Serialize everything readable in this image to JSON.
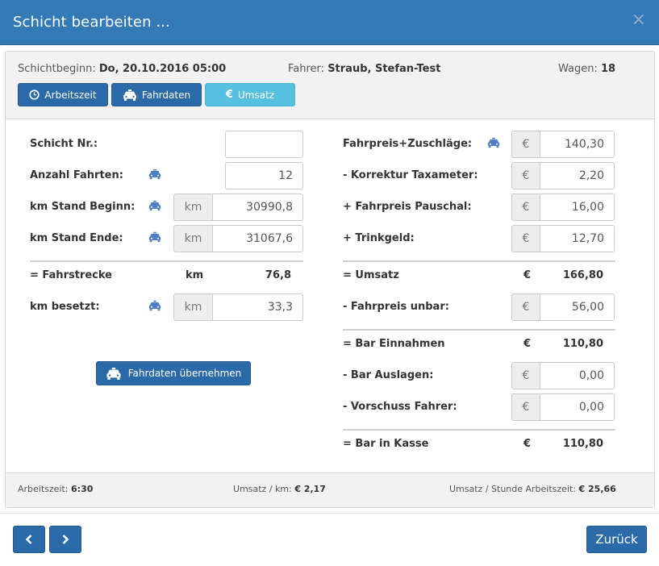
{
  "dialog": {
    "title": "Schicht bearbeiten ...",
    "close_symbol": "×"
  },
  "header": {
    "schichtbeginn_label": "Schichtbeginn:",
    "schichtbeginn_value": "Do, 20.10.2016 05:00",
    "fahrer_label": "Fahrer:",
    "fahrer_value": "Straub, Stefan-Test",
    "wagen_label": "Wagen:",
    "wagen_value": "18"
  },
  "tabs": [
    {
      "label": "Arbeitszeit",
      "icon": "clock-icon"
    },
    {
      "label": "Fahrdaten",
      "icon": "taxi-icon"
    },
    {
      "label": "Umsatz",
      "icon": "euro-icon",
      "active": true
    }
  ],
  "left": {
    "schicht_nr": {
      "label": "Schicht Nr.:",
      "value": ""
    },
    "anzahl_fahrten": {
      "label": "Anzahl Fahrten:",
      "value": "12"
    },
    "km_stand_beginn": {
      "label": "km Stand Beginn:",
      "unit": "km",
      "value": "30990,8"
    },
    "km_stand_ende": {
      "label": "km Stand Ende:",
      "unit": "km",
      "value": "31067,6"
    },
    "fahrstrecke": {
      "label": "= Fahrstrecke",
      "unit": "km",
      "value": "76,8"
    },
    "km_besetzt": {
      "label": "km besetzt:",
      "unit": "km",
      "value": "33,3"
    },
    "action_label": "Fahrdaten übernehmen"
  },
  "right": {
    "fahrpreis_zuschlaege": {
      "label": "Fahrpreis+Zuschläge:",
      "unit": "€",
      "value": "140,30"
    },
    "korrektur_taxameter": {
      "label": "- Korrektur Taxameter:",
      "unit": "€",
      "value": "2,20"
    },
    "fahrpreis_pauschal": {
      "label": "+ Fahrpreis Pauschal:",
      "unit": "€",
      "value": "16,00"
    },
    "trinkgeld": {
      "label": "+ Trinkgeld:",
      "unit": "€",
      "value": "12,70"
    },
    "umsatz": {
      "label": "= Umsatz",
      "unit": "€",
      "value": "166,80"
    },
    "fahrpreis_unbar": {
      "label": "- Fahrpreis unbar:",
      "unit": "€",
      "value": "56,00"
    },
    "bar_einnahmen": {
      "label": "= Bar Einnahmen",
      "unit": "€",
      "value": "110,80"
    },
    "bar_auslagen": {
      "label": "- Bar Auslagen:",
      "unit": "€",
      "value": "0,00"
    },
    "vorschuss_fahrer": {
      "label": "- Vorschuss Fahrer:",
      "unit": "€",
      "value": "0,00"
    },
    "bar_in_kasse": {
      "label": "= Bar in Kasse",
      "unit": "€",
      "value": "110,80"
    }
  },
  "footer": {
    "arbeitszeit_label": "Arbeitszeit:",
    "arbeitszeit_value": "6:30",
    "umsatz_km_label": "Umsatz / km:",
    "umsatz_km_value": "€ 2,17",
    "umsatz_stunde_label": "Umsatz / Stunde Arbeitszeit:",
    "umsatz_stunde_value": "€ 25,66"
  },
  "buttons": {
    "back_label": "Zurück"
  },
  "colors": {
    "primary": "#2b6aa8",
    "titlebar": "#337ab7",
    "active_tab": "#55c0e0",
    "icon": "#4f7fc4"
  }
}
